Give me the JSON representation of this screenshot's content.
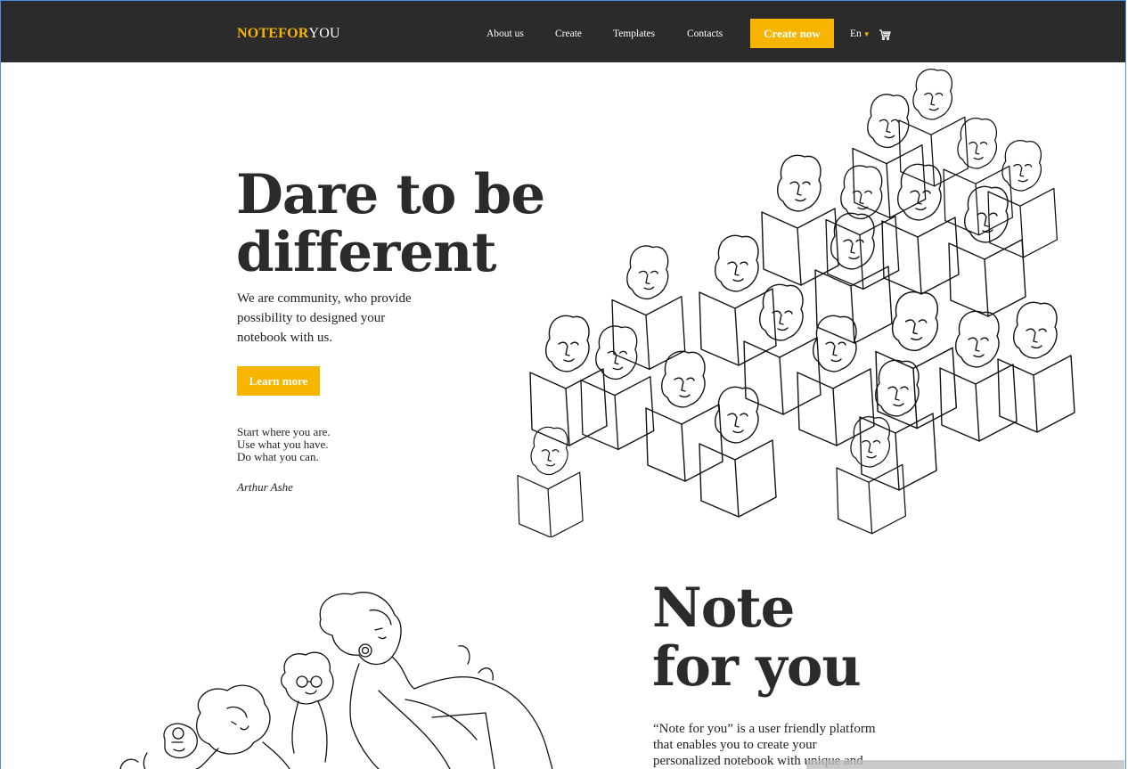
{
  "brand": {
    "part1": "NOTEFOR",
    "part2": "YOU"
  },
  "nav": {
    "items": [
      {
        "label": "About us"
      },
      {
        "label": "Create"
      },
      {
        "label": "Templates"
      },
      {
        "label": "Contacts"
      }
    ],
    "cta_label": "Create now",
    "language": "En",
    "cart_icon": "cart-icon"
  },
  "hero": {
    "title_line1": "Dare to be",
    "title_line2": "different",
    "subtitle": "We are community, who provide possibility to designed your notebook with us.",
    "button_label": "Learn more",
    "quote_lines": [
      "Start where you are.",
      "Use what you have.",
      "Do what you can."
    ],
    "quote_author": "Arthur Ashe",
    "illustration_icon": "choir-sketch-illustration"
  },
  "section2": {
    "title_line1": "Note",
    "title_line2": "for you",
    "description": "“Note for you”  is a user friendly platform that enables you to create your personalized notebook with unique and",
    "illustration_icon": "people-sketch-illustration"
  },
  "colors": {
    "accent": "#f7b500",
    "header_bg": "#2b2b2b",
    "title_text": "#2b2b2b"
  }
}
